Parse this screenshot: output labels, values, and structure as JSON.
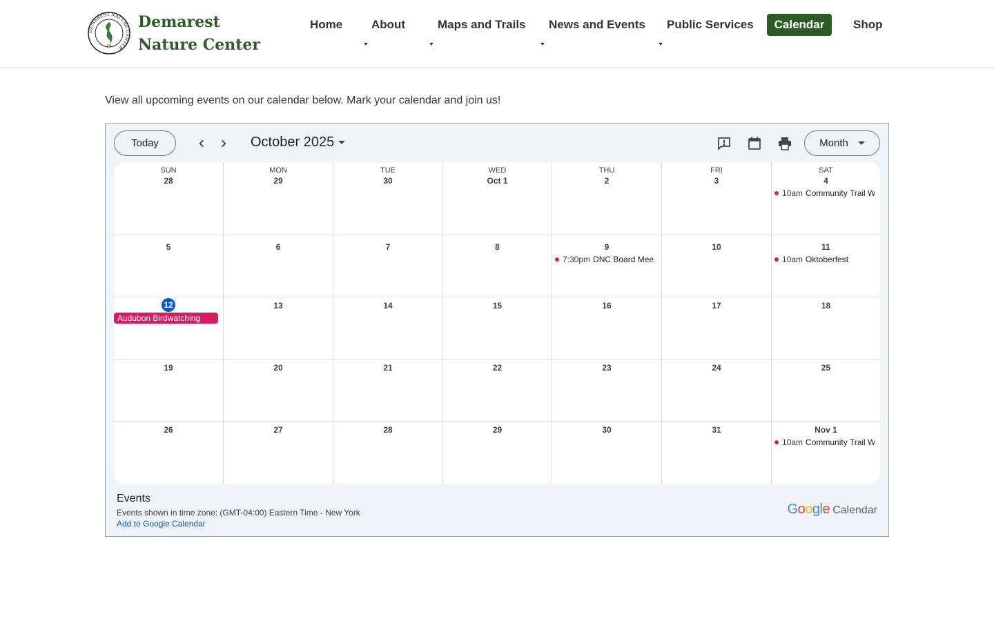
{
  "header": {
    "brand": "Demarest Nature Center",
    "logo_alt": "Demarest Nature Center heron seal",
    "logo_ring_text": "DEMAREST NATURE CENTER",
    "nav": [
      {
        "label": "Home",
        "has_dropdown": false
      },
      {
        "label": "About",
        "has_dropdown": true
      },
      {
        "label": "Maps and Trails",
        "has_dropdown": true
      },
      {
        "label": "News and Events",
        "has_dropdown": true
      },
      {
        "label": "Public Services",
        "has_dropdown": true
      },
      {
        "label": "Calendar",
        "active": true
      },
      {
        "label": "Shop",
        "has_dropdown": false
      }
    ],
    "brand_color": "#2d5a27"
  },
  "intro_text": "View all upcoming events on our calendar below. Mark your calendar and join us!",
  "calendar": {
    "today_label": "Today",
    "month_label": "October 2025",
    "view_label": "Month",
    "toolbar_icons": [
      "feedback-icon",
      "calendar-icon",
      "print-icon"
    ],
    "weekdays": [
      "SUN",
      "MON",
      "TUE",
      "WED",
      "THU",
      "FRI",
      "SAT"
    ],
    "weeks": [
      [
        "28",
        "29",
        "30",
        "Oct 1",
        "2",
        "3",
        "4"
      ],
      [
        "5",
        "6",
        "7",
        "8",
        "9",
        "10",
        "11"
      ],
      [
        "12",
        "13",
        "14",
        "15",
        "16",
        "17",
        "18"
      ],
      [
        "19",
        "20",
        "21",
        "22",
        "23",
        "24",
        "25"
      ],
      [
        "26",
        "27",
        "28",
        "29",
        "30",
        "31",
        "Nov 1"
      ]
    ],
    "today_date": "12",
    "events": {
      "oct4": {
        "time": "10am",
        "title": "Community Trail W"
      },
      "oct9": {
        "time": "7:30pm",
        "title": "DNC Board Mee"
      },
      "oct11": {
        "time": "10am",
        "title": "Oktoberfest"
      },
      "oct12": {
        "title": "Audubon Birdwatching"
      },
      "nov1": {
        "time": "10am",
        "title": "Community Trail W"
      }
    },
    "event_color": "#d81b60",
    "today_color": "#0b57d0",
    "footer": {
      "events_heading": "Events",
      "timezone": "Events shown in time zone: (GMT-04:00) Eastern Time - New York",
      "add_link": "Add to Google Calendar",
      "google_word": "Google",
      "calendar_word": "Calendar"
    }
  }
}
